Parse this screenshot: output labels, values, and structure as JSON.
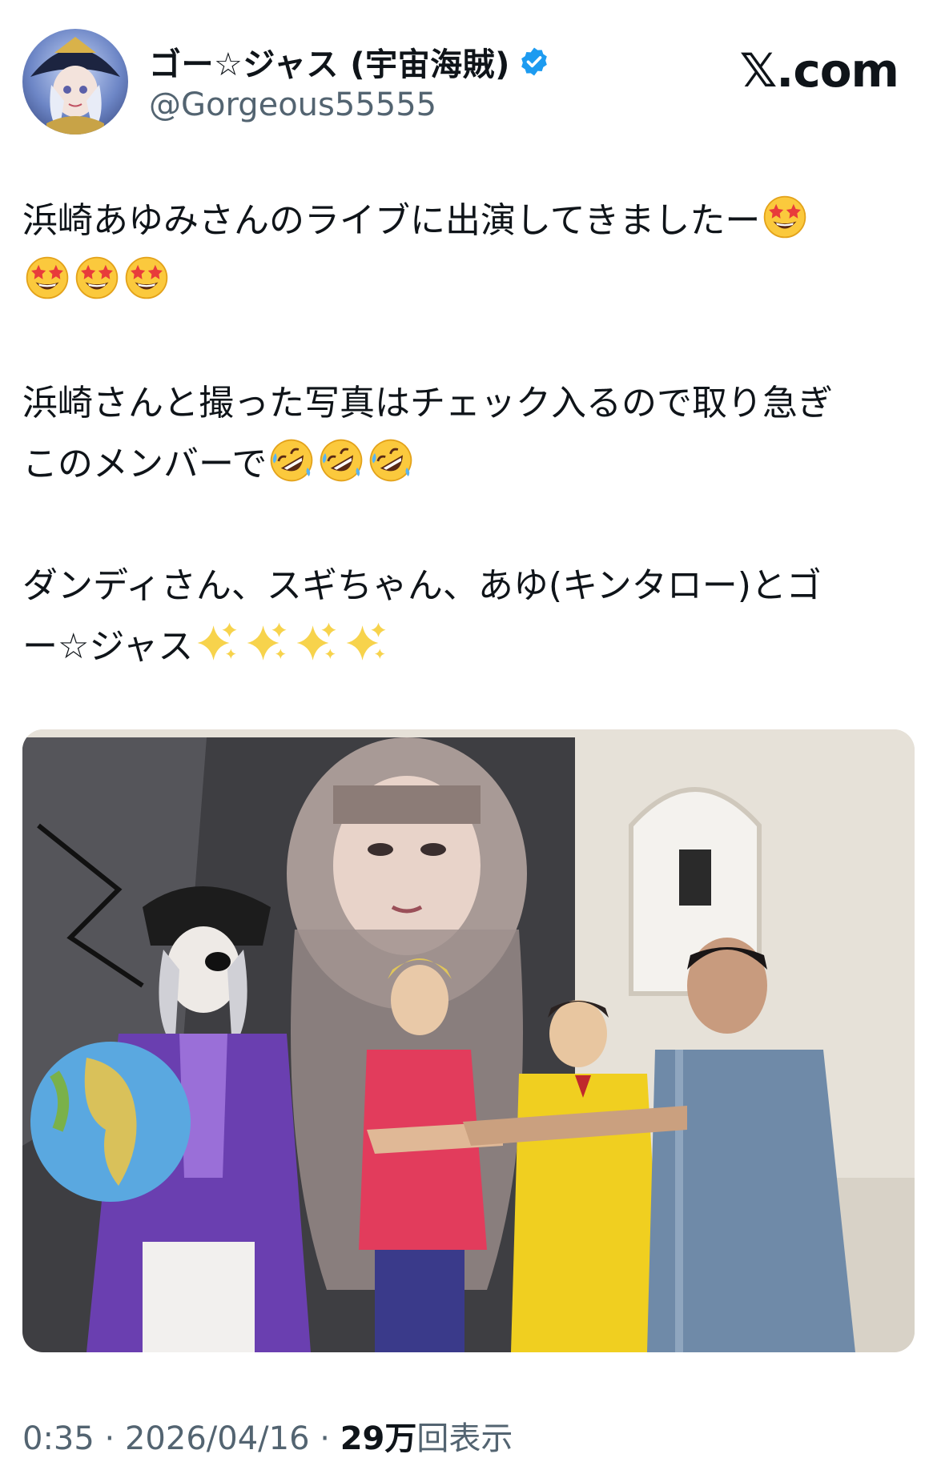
{
  "header": {
    "display_name": "ゴー☆ジャス (宇宙海賊)",
    "handle": "@Gorgeous55555",
    "site_logo": "𝕏.com",
    "verified_icon": "verified-badge-icon",
    "avatar_icon": "pirate-avatar"
  },
  "tweet": {
    "para1": "浜崎あゆみさんのライブに出演してきましたー",
    "para2_line1": "浜崎さんと撮った写真はチェック入るので取り急ぎ",
    "para2_line2": "このメンバーで",
    "para3_line1": "ダンディさん、スギちゃん、あゆ(キンタロー)とゴ",
    "para3_line2": "ー☆ジャス",
    "emoji_star_struck": "star-struck-emoji",
    "emoji_rofl": "rolling-on-floor-laughing-emoji",
    "emoji_sparkles": "sparkles-emoji"
  },
  "meta": {
    "time": "0:35",
    "sep": " · ",
    "date": "2026/04/16",
    "views_number": "29万",
    "views_label": "回表示"
  },
  "colors": {
    "verified": "#1d9bf0",
    "text": "#0f1419",
    "secondary": "#536471"
  }
}
